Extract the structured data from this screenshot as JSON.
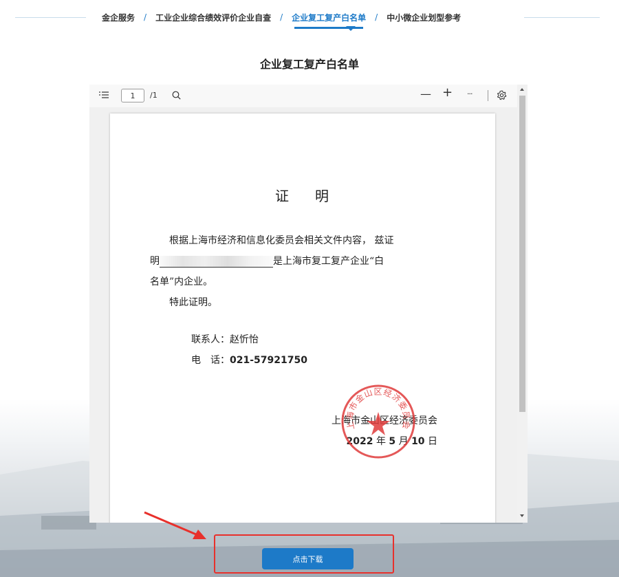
{
  "breadcrumb": {
    "items": [
      {
        "label": "金企服务"
      },
      {
        "label": "工业企业综合绩效评价企业自查"
      },
      {
        "label": "企业复工复产白名单"
      },
      {
        "label": "中小微企业划型参考"
      }
    ],
    "separator": "/",
    "active_index": 2
  },
  "page_title": "企业复工复产白名单",
  "pdf_viewer": {
    "toolbar": {
      "outline_icon": "list-icon",
      "page_number": "1",
      "page_total": "/1",
      "search_icon": "search-icon",
      "zoom_out": "—",
      "zoom_in": "+",
      "more": "···",
      "settings_icon": "gear-icon"
    },
    "document": {
      "title_left": "证",
      "title_right": "明",
      "paragraph_line1": "根据上海市经济和信息化委员会相关文件内容， 兹证",
      "paragraph_line2_prefix": "明",
      "paragraph_line2_suffix": "是上海市复工复产企业“白",
      "paragraph_line3": "名单”内企业。",
      "closing": "特此证明。",
      "contact_label": "联系人：赵忻怡",
      "phone_label": "电　话：",
      "phone_number": "021-57921750",
      "signature_org": "上海市金山区经济委员会",
      "date_year": "2022",
      "date_year_unit": "年",
      "date_month": "5",
      "date_month_unit": "月",
      "date_day": "10",
      "date_day_unit": "日",
      "stamp_text": "上海市金山区经济委员会"
    }
  },
  "download_button": {
    "label": "点击下载"
  },
  "colors": {
    "accent": "#1d7ac8",
    "highlight_frame": "#e8302b",
    "stamp": "#e03c3c"
  }
}
